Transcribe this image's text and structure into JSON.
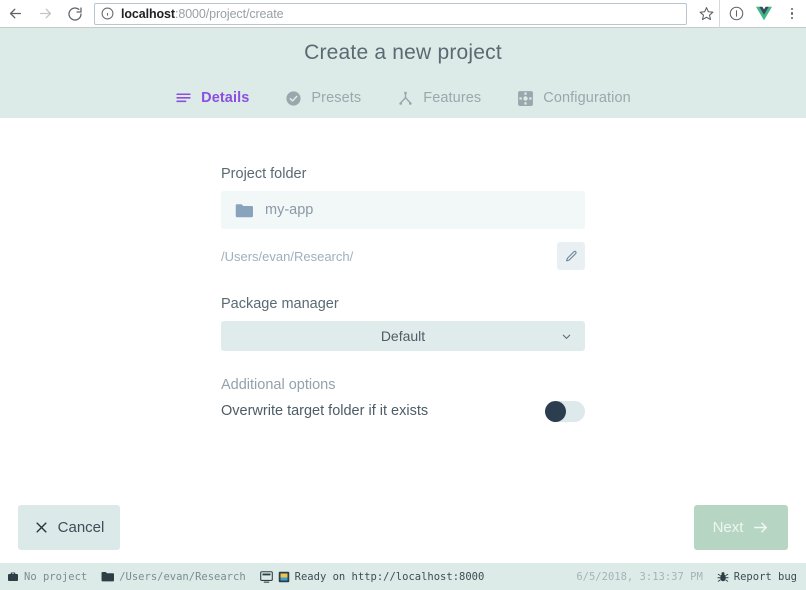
{
  "browser": {
    "back_icon": "arrow-left-icon",
    "forward_icon": "arrow-right-icon",
    "reload_icon": "reload-icon",
    "info_icon": "info-circle-icon",
    "url_host": "localhost",
    "url_rest": ":8000/project/create",
    "url_full": "localhost:8000/project/create",
    "star_icon": "star-icon",
    "extension_info_icon": "info-circle-icon",
    "vue_icon": "vue-logo-icon",
    "menu_icon": "three-dots-menu-icon"
  },
  "wizard": {
    "title": "Create a new project",
    "tabs": [
      {
        "label": "Details",
        "icon": "list-lines-icon",
        "active": true
      },
      {
        "label": "Presets",
        "icon": "check-circle-icon",
        "active": false
      },
      {
        "label": "Features",
        "icon": "sitemap-icon",
        "active": false
      },
      {
        "label": "Configuration",
        "icon": "settings-square-icon",
        "active": false
      }
    ],
    "accent_color": "#8c4fe0",
    "header_bg": "#dcebe8"
  },
  "form": {
    "project_folder_label": "Project folder",
    "project_folder_value": "my-app",
    "project_folder_icon": "folder-icon",
    "path_text": "/Users/evan/Research/",
    "edit_icon": "pencil-edit-icon",
    "package_manager_label": "Package manager",
    "package_manager_value": "Default",
    "package_manager_caret": "chevron-down-icon",
    "additional_options_label": "Additional options",
    "overwrite_label": "Overwrite target folder if it exists",
    "overwrite_enabled": false
  },
  "footer": {
    "cancel_label": "Cancel",
    "cancel_icon": "close-x-icon",
    "next_label": "Next",
    "next_icon": "arrow-right-icon",
    "next_color": "#b7d5c3"
  },
  "statusbar": {
    "project_icon": "briefcase-icon",
    "project_text": "No project",
    "folder_icon": "folder-icon",
    "folder_text": "/Users/evan/Research",
    "terminal_icon": "terminal-icon",
    "task_icon": "task-square-icon",
    "ready_text": "Ready on http://localhost:8000",
    "timestamp": "6/5/2018, 3:13:37 PM",
    "bug_icon": "bug-icon",
    "report_bug_text": "Report bug"
  }
}
